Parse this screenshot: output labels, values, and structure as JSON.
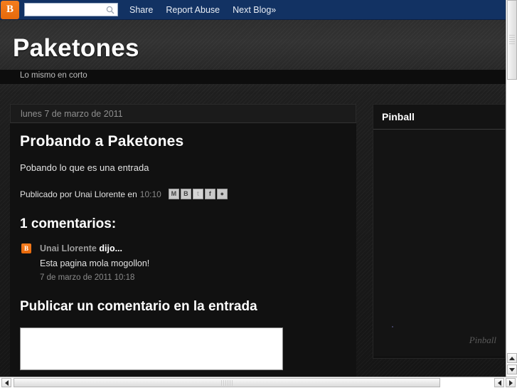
{
  "navbar": {
    "logo_letter": "B",
    "search_placeholder": "",
    "search_value": "",
    "links": [
      {
        "label": "Share"
      },
      {
        "label": "Report Abuse"
      },
      {
        "label": "Next Blog»"
      }
    ]
  },
  "header": {
    "title": "Paketones",
    "description": "Lo mismo en corto"
  },
  "post": {
    "date": "lunes 7 de marzo de 2011",
    "title": "Probando a Paketones",
    "body": "Pobando lo que es una entrada",
    "footer_prefix": "Publicado por Unai Llorente en",
    "time": "10:10",
    "share_buttons": [
      {
        "name": "email-share",
        "glyph": "M"
      },
      {
        "name": "blogger-share",
        "glyph": "B"
      },
      {
        "name": "twitter-share",
        "glyph": "t"
      },
      {
        "name": "facebook-share",
        "glyph": "f"
      },
      {
        "name": "buzz-share",
        "glyph": "●"
      }
    ]
  },
  "comments": {
    "heading": "1 comentarios:",
    "items": [
      {
        "avatar_letter": "B",
        "author": "Unai Llorente",
        "said": "dijo...",
        "text": "Esta pagina mola mogollon!",
        "timestamp": "7 de marzo de 2011 10:18"
      }
    ],
    "form_heading": "Publicar un comentario en la entrada",
    "textarea_value": "",
    "textarea_placeholder": ""
  },
  "sidebar": {
    "gadget_title": "Pinball",
    "watermark": "Pinball"
  },
  "colors": {
    "navbar_bg": "#123263",
    "blogger_orange": "#e8690b",
    "page_bg": "#1c1c1c",
    "post_bg": "#111111",
    "text_primary": "#ffffff",
    "text_muted": "#8a8a8a"
  }
}
